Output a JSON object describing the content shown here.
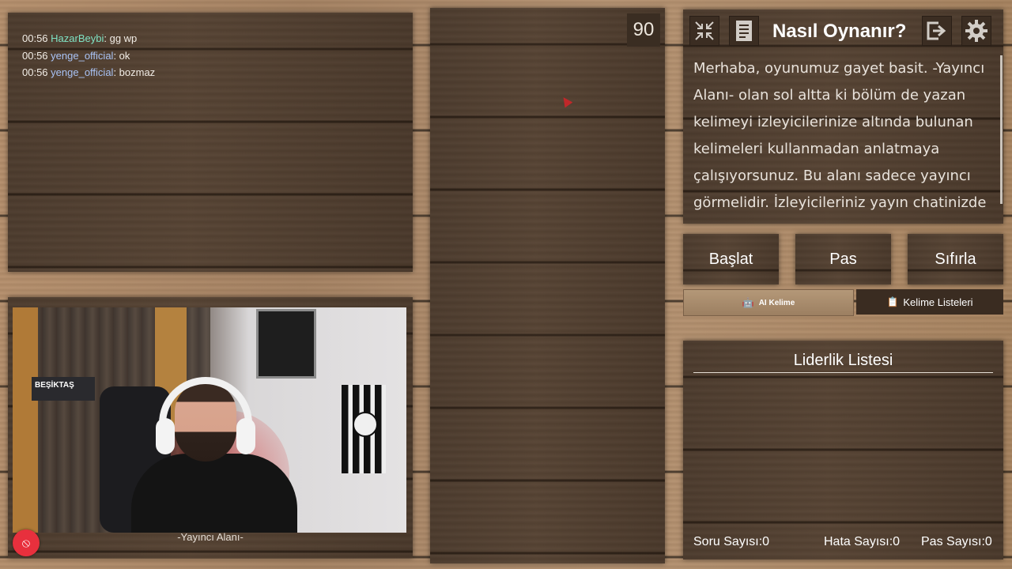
{
  "chat": {
    "messages": [
      {
        "time": "00:56",
        "user": "HazarBeybi",
        "text": ": gg wp",
        "color": "#7fe3c4"
      },
      {
        "time": "00:56",
        "user": "yenge_official",
        "text": ": ok",
        "color": "#a9c3f5"
      },
      {
        "time": "00:56",
        "user": "yenge_official",
        "text": ": bozmaz",
        "color": "#a9c3f5"
      }
    ]
  },
  "timer": {
    "value": "90"
  },
  "info": {
    "title": "Nasıl Oynanır?",
    "text": "Merhaba, oyunumuz gayet basit. -Yayıncı Alanı- olan sol altta ki bölüm de yazan kelimeyi izleyicilerinize altında bulunan kelimeleri kullanmadan anlatmaya çalışıyorsunuz. Bu alanı sadece yayıncı görmelidir. İzleyicileriniz yayın chatinizde"
  },
  "icons": {
    "compress": "compress-arrows-icon",
    "doc": "document-icon",
    "exit": "exit-icon",
    "settings": "gear-icon",
    "ai": "robot-icon",
    "lists": "clipboard-icon",
    "record": "record-icon"
  },
  "controls": {
    "start": "Başlat",
    "pass": "Pas",
    "reset": "Sıfırla",
    "ai_word": "AI Kelime",
    "word_lists": "Kelime Listeleri"
  },
  "leaderboard": {
    "title": "Liderlik Listesi",
    "soru_label": "Soru Sayısı:",
    "soru_value": "0",
    "hata_label": "Hata Sayısı:",
    "hata_value": "0",
    "pas_label": "Pas Sayısı:",
    "pas_value": "0"
  },
  "stream": {
    "label": "-Yayıncı Alanı-",
    "sign_text": "BEŞİKTAŞ"
  },
  "colors": {
    "ai_button": "#b49878",
    "panel_dark": "#4d3c2e",
    "record_red": "#e8303d"
  }
}
